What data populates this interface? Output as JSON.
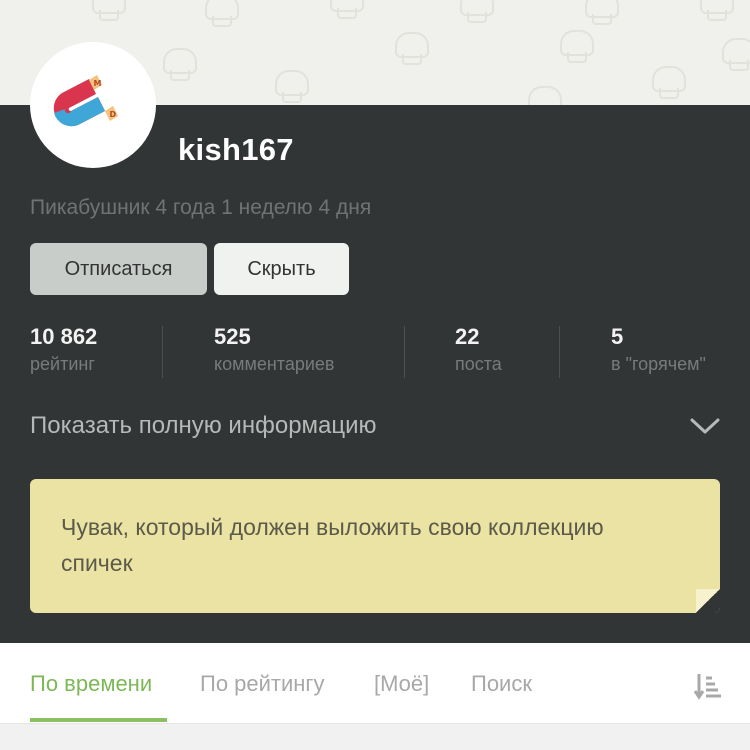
{
  "profile": {
    "username": "kish167",
    "since": "Пикабушник 4 года 1 неделю 4 дня",
    "avatar": {
      "icon": "magnet-icon",
      "letters": [
        "M",
        "D"
      ],
      "colors": {
        "red": "#d9354e",
        "blue": "#3fa7d8",
        "tip": "#f4c27a"
      }
    }
  },
  "actions": {
    "unsubscribe_label": "Отписаться",
    "hide_label": "Скрыть"
  },
  "stats": [
    {
      "value": "10 862",
      "label": "рейтинг"
    },
    {
      "value": "525",
      "label": "комментариев"
    },
    {
      "value": "22",
      "label": "поста"
    },
    {
      "value": "5",
      "label": "в \"горячем\""
    }
  ],
  "info": {
    "show_full_label": "Показать полную информацию",
    "icon": "chevron-down-icon"
  },
  "note": {
    "text": "Чувак, который должен выложить свою коллекцию спичек"
  },
  "tabs": [
    {
      "label": "По времени",
      "active": true
    },
    {
      "label": "По рейтингу",
      "active": false
    },
    {
      "label": "[Моё]",
      "active": false
    },
    {
      "label": "Поиск",
      "active": false
    }
  ],
  "sort_icon": "sort-icon",
  "colors": {
    "panel": "#323535",
    "accent": "#7cb856",
    "note_bg": "#ebe3a4"
  }
}
